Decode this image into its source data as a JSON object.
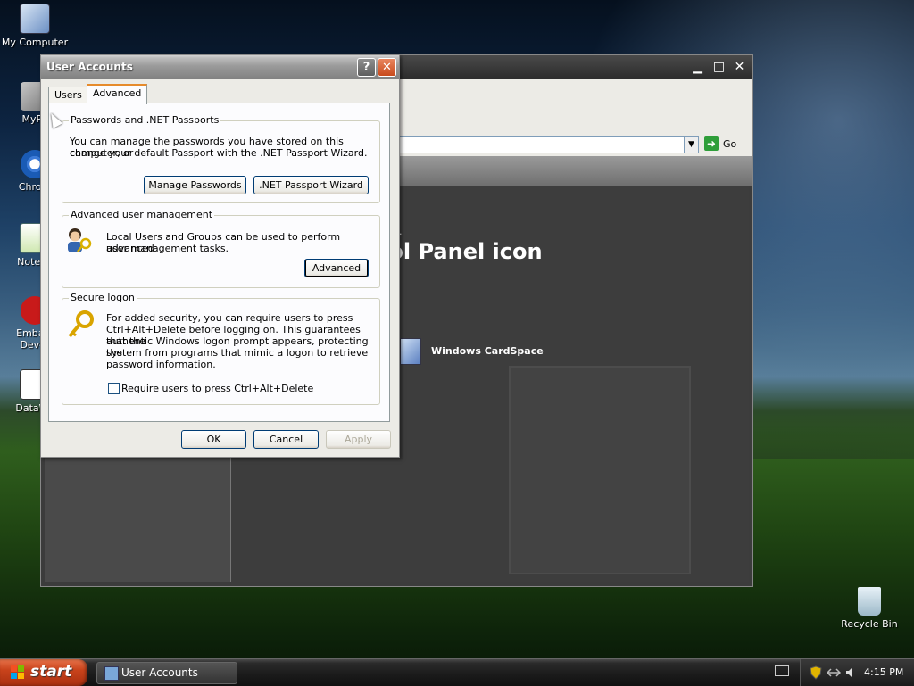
{
  "desktop": {
    "icons": [
      {
        "label": "My Computer",
        "icon": "my-computer-icon"
      },
      {
        "label": "MyPa",
        "icon": "my-pad-icon"
      },
      {
        "label": "Chrom",
        "icon": "chrome-icon"
      },
      {
        "label": "Notepa",
        "icon": "notepad-icon"
      },
      {
        "label": "Embarc",
        "label2": "Dev-C",
        "icon": "embarcadero-dev-icon"
      },
      {
        "label": "DataWa",
        "icon": "datawatch-icon"
      },
      {
        "label": "Recycle Bin",
        "icon": "recycle-bin-icon"
      }
    ]
  },
  "control_panel_window": {
    "heading": "ntrol Panel icon",
    "item": "Windows CardSpace",
    "go_label": "Go",
    "dot": "."
  },
  "dialog": {
    "title": "User Accounts",
    "help_glyph": "?",
    "close_glyph": "✕",
    "tabs": {
      "users": "Users",
      "advanced": "Advanced"
    },
    "passwords": {
      "title": "Passwords and .NET Passports",
      "text_line1": "You can manage the passwords you have stored on this computer, or",
      "text_line2": "change your default Passport with the .NET Passport Wizard.",
      "manage_button": "Manage Passwords",
      "wizard_button": ".NET Passport Wizard"
    },
    "user_management": {
      "title": "Advanced user management",
      "text_line1": "Local Users and Groups can be used to perform advanced",
      "text_line2": "user management tasks.",
      "advanced_button": "Advanced"
    },
    "secure_logon": {
      "title": "Secure logon",
      "lines": [
        "For added security, you can require users to press",
        "Ctrl+Alt+Delete before logging on. This guarantees that the",
        "authentic Windows logon prompt appears, protecting the",
        "system from programs that mimic a logon to retrieve",
        "password information."
      ],
      "checkbox_label": "Require users to press Ctrl+Alt+Delete",
      "checked": false
    },
    "ok": "OK",
    "cancel": "Cancel",
    "apply": "Apply"
  },
  "taskbar": {
    "start_label": "start",
    "task_label": "User Accounts",
    "clock": "4:15 PM"
  },
  "colors": {
    "start_orange": "#c9431b",
    "tab_highlight": "#e68b2c",
    "button_border": "#003c74",
    "close_red": "#c84a1c"
  }
}
